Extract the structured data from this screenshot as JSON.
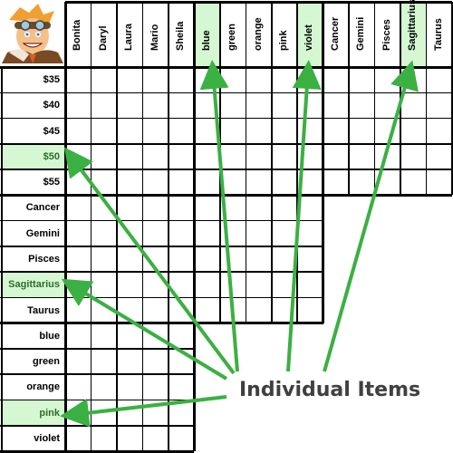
{
  "column_headers": {
    "people": [
      "Bonita",
      "Daryl",
      "Laura",
      "Mario",
      "Sheila"
    ],
    "colors": [
      "blue",
      "green",
      "orange",
      "pink",
      "violet"
    ],
    "signs": [
      "Cancer",
      "Gemini",
      "Pisces",
      "Sagittarius",
      "Taurus"
    ]
  },
  "row_headers": {
    "prices": [
      "$35",
      "$40",
      "$45",
      "$50",
      "$55"
    ],
    "signs": [
      "Cancer",
      "Gemini",
      "Pisces",
      "Sagittarius",
      "Taurus"
    ],
    "colors": [
      "blue",
      "green",
      "orange",
      "pink",
      "violet"
    ]
  },
  "highlighted": {
    "columns": [
      "blue",
      "violet",
      "Sagittarius"
    ],
    "rows": [
      "$50",
      "Sagittarius",
      "pink"
    ]
  },
  "callout_label": "Individual Items",
  "colors": {
    "highlight_fill": "#d5f8d2",
    "arrow": "#3bb043",
    "callout_text": "#404040",
    "grid": "#000000"
  },
  "mascot_icon": "cartoon-aviator-mascot"
}
